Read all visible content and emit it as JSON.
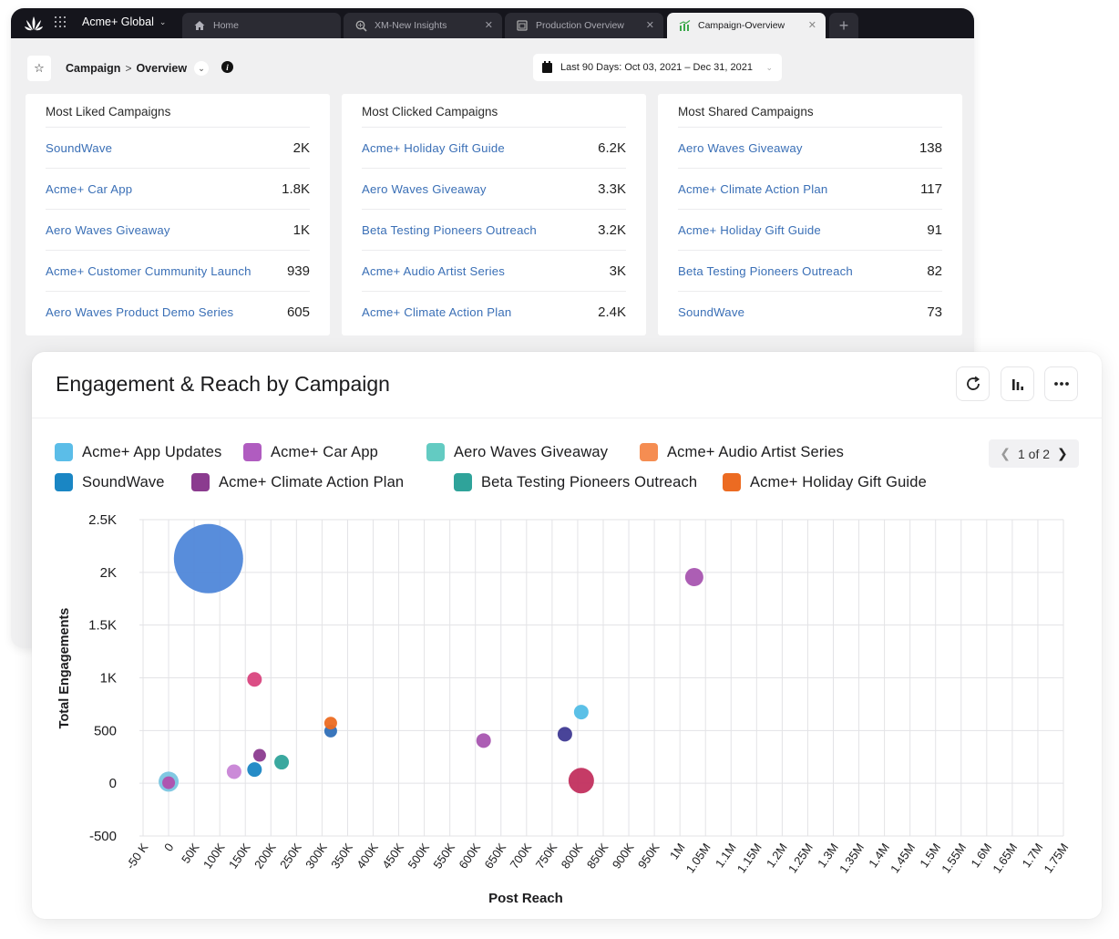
{
  "window": {
    "workspace": "Acme+ Global",
    "tabs": [
      {
        "label": "Home",
        "icon": "home-icon",
        "active": false,
        "closable": false
      },
      {
        "label": "XM-New Insights",
        "icon": "insights-icon",
        "active": false,
        "closable": true
      },
      {
        "label": "Production Overview",
        "icon": "dashboard-icon",
        "active": false,
        "closable": true
      },
      {
        "label": "Campaign-Overview",
        "icon": "chart-icon",
        "active": true,
        "closable": true
      }
    ],
    "new_tab": "+"
  },
  "subbar": {
    "breadcrumb_root": "Campaign",
    "breadcrumb_sep": ">",
    "breadcrumb_page": "Overview",
    "date_range": "Last 90 Days: Oct 03, 2021 – Dec 31, 2021"
  },
  "cards": [
    {
      "title": "Most Liked Campaigns",
      "rows": [
        {
          "name": "SoundWave",
          "value": "2K"
        },
        {
          "name": "Acme+ Car App",
          "value": "1.8K"
        },
        {
          "name": "Aero Waves Giveaway",
          "value": "1K"
        },
        {
          "name": "Acme+ Customer Cummunity Launch",
          "value": "939"
        },
        {
          "name": "Aero Waves Product Demo Series",
          "value": "605"
        }
      ]
    },
    {
      "title": "Most Clicked Campaigns",
      "rows": [
        {
          "name": "Acme+ Holiday Gift Guide",
          "value": "6.2K"
        },
        {
          "name": "Aero Waves Giveaway",
          "value": "3.3K"
        },
        {
          "name": "Beta Testing Pioneers Outreach",
          "value": "3.2K"
        },
        {
          "name": "Acme+ Audio Artist Series",
          "value": "3K"
        },
        {
          "name": "Acme+ Climate Action Plan",
          "value": "2.4K"
        }
      ]
    },
    {
      "title": "Most Shared Campaigns",
      "rows": [
        {
          "name": "Aero Waves Giveaway",
          "value": "138"
        },
        {
          "name": "Acme+ Climate Action Plan",
          "value": "117"
        },
        {
          "name": "Acme+ Holiday Gift Guide",
          "value": "91"
        },
        {
          "name": "Beta Testing Pioneers Outreach",
          "value": "82"
        },
        {
          "name": "SoundWave",
          "value": "73"
        }
      ]
    }
  ],
  "panel": {
    "title": "Engagement & Reach by Campaign",
    "actions": [
      "refresh",
      "chart-type",
      "more"
    ],
    "pager": "1 of 2"
  },
  "chart_data": {
    "type": "scatter",
    "subtype": "bubble",
    "title": "Engagement & Reach by Campaign",
    "xlabel": "Post Reach",
    "ylabel": "Total Engagements",
    "xlim": [
      -50000,
      1750000
    ],
    "ylim": [
      -500,
      2500
    ],
    "grid": true,
    "legend_position": "top-left",
    "x_ticks": [
      "-50 K",
      "0",
      "50K",
      "100K",
      "150K",
      "200K",
      "250K",
      "300K",
      "350K",
      "400K",
      "450K",
      "500K",
      "550K",
      "600K",
      "650K",
      "700K",
      "750K",
      "800K",
      "850K",
      "900K",
      "950K",
      "1M",
      "1.05M",
      "1.1M",
      "1.15M",
      "1.2M",
      "1.25M",
      "1.3M",
      "1.35M",
      "1.4M",
      "1.45M",
      "1.5M",
      "1.55M",
      "1.6M",
      "1.65M",
      "1.7M",
      "1.75M"
    ],
    "y_ticks": [
      "2.5K",
      "2K",
      "1.5K",
      "1K",
      "500",
      "0",
      "-500"
    ],
    "legend": [
      {
        "name": "Acme+ App Updates",
        "color": "#5bbde8"
      },
      {
        "name": "Acme+ Car App",
        "color": "#b05cc0"
      },
      {
        "name": "Aero Waves Giveaway",
        "color": "#63cbc2"
      },
      {
        "name": "Acme+ Audio Artist Series",
        "color": "#f58d52"
      },
      {
        "name": "SoundWave",
        "color": "#1a86c4"
      },
      {
        "name": "Acme+ Climate Action Plan",
        "color": "#8b3b8f"
      },
      {
        "name": "Beta Testing Pioneers Outreach",
        "color": "#2fa39a"
      },
      {
        "name": "Acme+ Holiday Gift Guide",
        "color": "#ec6b22"
      }
    ],
    "points": [
      {
        "x": 78000,
        "y": 2130,
        "size": 38,
        "color": "#4f87d9"
      },
      {
        "x": 0,
        "y": 15,
        "size": 11,
        "color": "#7ac5e0"
      },
      {
        "x": 0,
        "y": 5,
        "size": 7,
        "color": "#b04fad"
      },
      {
        "x": 128000,
        "y": 110,
        "size": 8,
        "color": "#c884d6"
      },
      {
        "x": 168000,
        "y": 130,
        "size": 8,
        "color": "#1a86c4"
      },
      {
        "x": 168000,
        "y": 985,
        "size": 8,
        "color": "#d9447e"
      },
      {
        "x": 178000,
        "y": 265,
        "size": 7,
        "color": "#8b3b8f"
      },
      {
        "x": 221000,
        "y": 200,
        "size": 8,
        "color": "#2fa39a"
      },
      {
        "x": 317000,
        "y": 495,
        "size": 7,
        "color": "#2f6fb8"
      },
      {
        "x": 317000,
        "y": 570,
        "size": 7,
        "color": "#ec6b22"
      },
      {
        "x": 616000,
        "y": 405,
        "size": 8,
        "color": "#a855b0"
      },
      {
        "x": 775000,
        "y": 465,
        "size": 8,
        "color": "#3f3a94"
      },
      {
        "x": 807000,
        "y": 675,
        "size": 8,
        "color": "#52bde6"
      },
      {
        "x": 807000,
        "y": 25,
        "size": 14,
        "color": "#c2305e"
      },
      {
        "x": 1028000,
        "y": 1955,
        "size": 10,
        "color": "#a855b0"
      }
    ]
  }
}
